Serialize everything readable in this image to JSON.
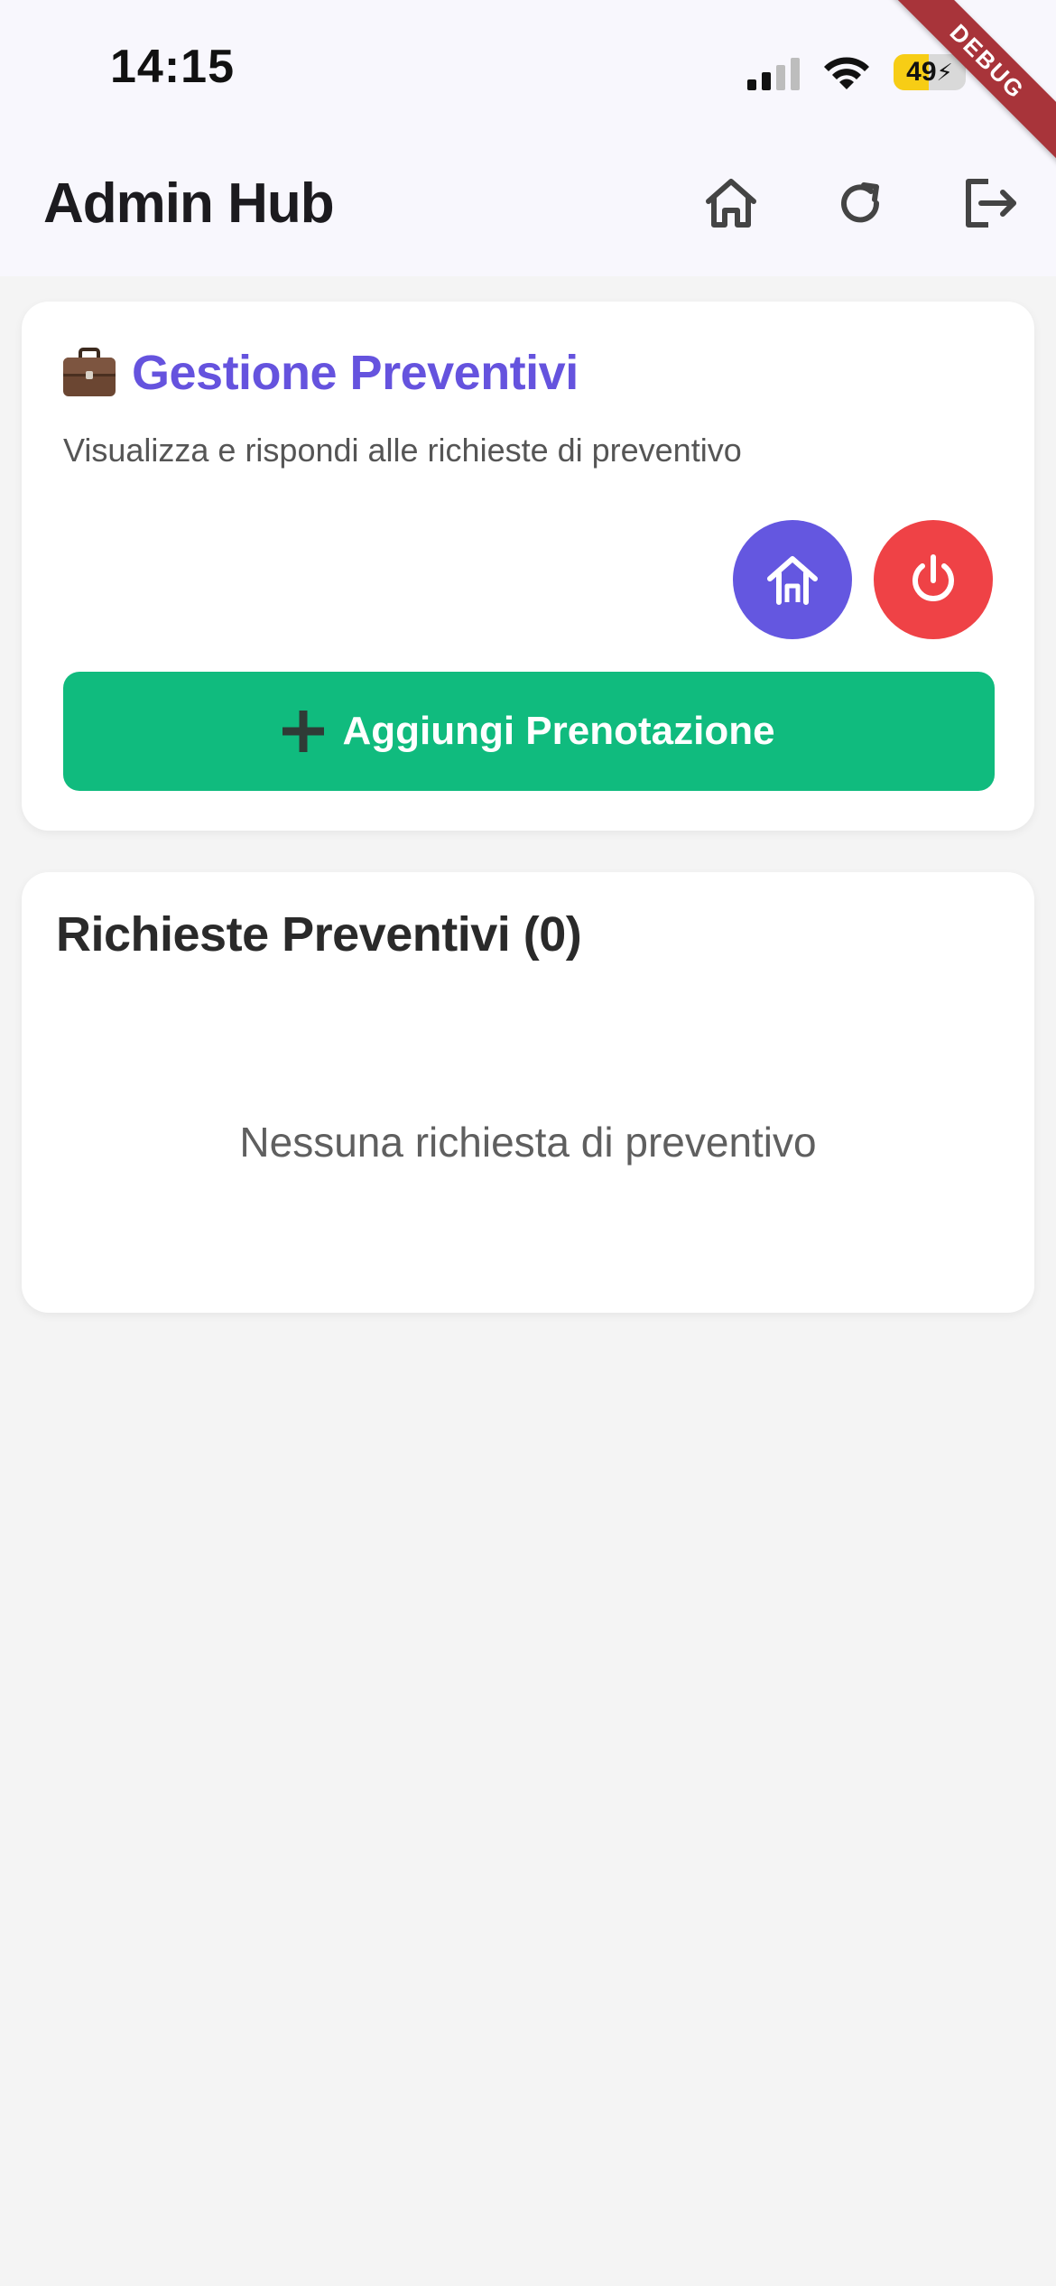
{
  "status_bar": {
    "time": "14:15",
    "battery_percent": 49,
    "battery_text": "49",
    "battery_color": "#f7cd15"
  },
  "debug_banner": "DEBUG",
  "app_bar": {
    "title": "Admin Hub",
    "actions": [
      "home-icon",
      "refresh-icon",
      "logout-icon"
    ]
  },
  "header_card": {
    "title": "Gestione Preventivi",
    "subtitle": "Visualizza e rispondi alle richieste di preventivo",
    "title_icon": "briefcase-icon",
    "title_color": "#6553de",
    "add_button_label": "Aggiungi Prenotazione",
    "add_button_color": "#10bb7e",
    "home_button_color": "#6457e0",
    "power_button_color": "#ef4246"
  },
  "requests_card": {
    "title": "Richieste Preventivi (0)",
    "empty_message": "Nessuna richiesta di preventivo"
  }
}
